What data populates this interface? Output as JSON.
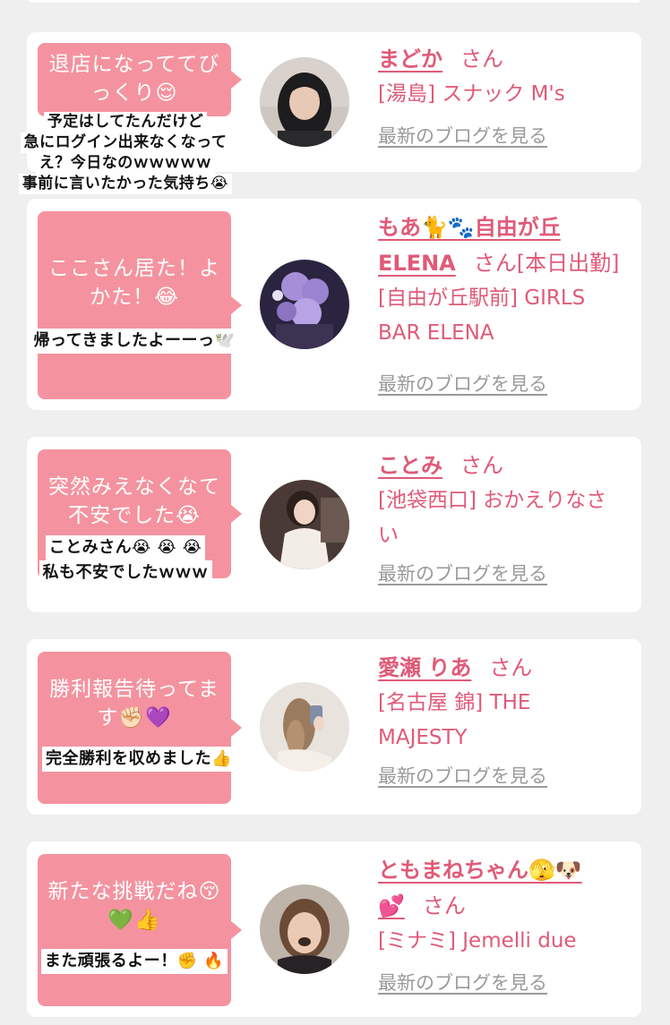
{
  "colors": {
    "accent": "#e05a78",
    "bubble": "#f4939f",
    "link_gray": "#9a9a9a",
    "background": "#efefef"
  },
  "cards": [
    {
      "comment_lines": [
        "退店になっててび",
        "っくり😌"
      ],
      "reply_lines": [
        "予定はしてたんだけど",
        "急にログイン出来なくなって",
        "え？今日なのｗｗｗｗｗ",
        "事前に言いたかった気持ち😭"
      ],
      "name": "まどか",
      "suffix": "さん",
      "shop_lines": [
        "[湯島] スナック M's"
      ],
      "blog_link": "最新のブログを見る"
    },
    {
      "comment_lines": [
        "ここさん居た！よ",
        "かた！😂"
      ],
      "reply_lines": [
        "帰ってきましたよーーっ🕊️"
      ],
      "name_lines": [
        "もあ🐈🐾自由が丘",
        "ELENA"
      ],
      "suffix": "さん[本日出勤]",
      "shop_lines": [
        "[自由が丘駅前] GIRLS",
        "BAR ELENA"
      ],
      "blog_link": "最新のブログを見る"
    },
    {
      "comment_lines": [
        "突然みえなくなて",
        "不安でした😭"
      ],
      "reply_lines": [
        "ことみさん😭 😭 😭",
        "私も不安でしたｗｗｗ"
      ],
      "name": "ことみ",
      "suffix": "さん",
      "shop_lines": [
        "[池袋西口] おかえりなさ",
        "い"
      ],
      "blog_link": "最新のブログを見る"
    },
    {
      "comment_lines": [
        "勝利報告待ってま",
        "す✊🏻💜"
      ],
      "reply_lines": [
        "完全勝利を収めました👍"
      ],
      "name": "愛瀬 りあ",
      "suffix": "さん",
      "shop_lines": [
        "[名古屋 錦] THE",
        "MAJESTY"
      ],
      "blog_link": "最新のブログを見る"
    },
    {
      "comment_lines": [
        "新たな挑戦だね😚",
        "💚👍"
      ],
      "reply_lines": [
        "また頑張るよー！✊ 🔥"
      ],
      "name_lines": [
        "ともまねちゃん🫣🐶",
        "💕"
      ],
      "suffix": "さん",
      "shop_lines": [
        "[ミナミ] Jemelli due"
      ],
      "blog_link": "最新のブログを見る"
    }
  ]
}
